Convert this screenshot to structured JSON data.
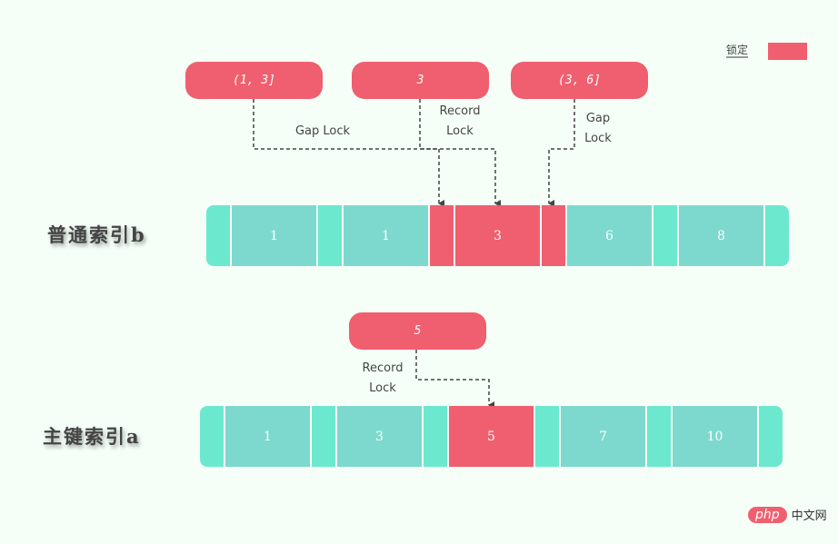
{
  "legend": {
    "label": "锁定",
    "color": "#f05f6f"
  },
  "colors": {
    "locked": "#f05f6f",
    "record": "#7dd9ce",
    "gap": "#6ce8cf",
    "background": "#f5fff7"
  },
  "secondary_index": {
    "title": "普通索引b",
    "segments": [
      {
        "type": "gap",
        "value": "",
        "locked": false
      },
      {
        "type": "record",
        "value": "1",
        "locked": false
      },
      {
        "type": "gap",
        "value": "",
        "locked": false
      },
      {
        "type": "record",
        "value": "1",
        "locked": false
      },
      {
        "type": "gap",
        "value": "",
        "locked": true
      },
      {
        "type": "record",
        "value": "3",
        "locked": true
      },
      {
        "type": "gap",
        "value": "",
        "locked": true
      },
      {
        "type": "record",
        "value": "6",
        "locked": false
      },
      {
        "type": "gap",
        "value": "",
        "locked": false
      },
      {
        "type": "record",
        "value": "8",
        "locked": false
      },
      {
        "type": "gap",
        "value": "",
        "locked": false
      }
    ],
    "locks": [
      {
        "range": "(1, 3]",
        "label_line1": "Gap Lock",
        "label_line2": ""
      },
      {
        "range": "3",
        "label_line1": "Record",
        "label_line2": "Lock"
      },
      {
        "range": "(3, 6]",
        "label_line1": "Gap",
        "label_line2": "Lock"
      }
    ]
  },
  "primary_index": {
    "title": "主键索引a",
    "segments": [
      {
        "type": "gap",
        "value": "",
        "locked": false
      },
      {
        "type": "record",
        "value": "1",
        "locked": false
      },
      {
        "type": "gap",
        "value": "",
        "locked": false
      },
      {
        "type": "record",
        "value": "3",
        "locked": false
      },
      {
        "type": "gap",
        "value": "",
        "locked": false
      },
      {
        "type": "record",
        "value": "5",
        "locked": true
      },
      {
        "type": "gap",
        "value": "",
        "locked": false
      },
      {
        "type": "record",
        "value": "7",
        "locked": false
      },
      {
        "type": "gap",
        "value": "",
        "locked": false
      },
      {
        "type": "record",
        "value": "10",
        "locked": false
      },
      {
        "type": "gap",
        "value": "",
        "locked": false
      }
    ],
    "locks": [
      {
        "range": "5",
        "label_line1": "Record",
        "label_line2": "Lock"
      }
    ]
  },
  "watermark": {
    "logo": "php",
    "text": "中文网"
  }
}
